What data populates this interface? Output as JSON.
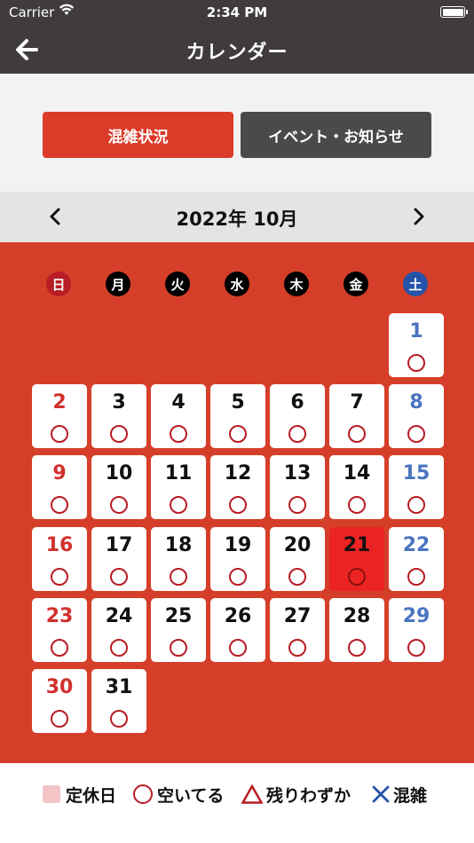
{
  "status_bar": {
    "carrier": "Carrier",
    "time": "2:34 PM"
  },
  "nav": {
    "title": "カレンダー"
  },
  "segments": [
    {
      "label": "混雑状況",
      "active": true
    },
    {
      "label": "イベント・お知らせ",
      "active": false
    }
  ],
  "month": {
    "label": "2022年 10月"
  },
  "weekdays": [
    "日",
    "月",
    "火",
    "水",
    "木",
    "金",
    "土"
  ],
  "days": [
    {
      "day": "1",
      "col": 6,
      "row": 0
    },
    {
      "day": "2",
      "col": 0,
      "row": 1
    },
    {
      "day": "3",
      "col": 1,
      "row": 1
    },
    {
      "day": "4",
      "col": 2,
      "row": 1
    },
    {
      "day": "5",
      "col": 3,
      "row": 1
    },
    {
      "day": "6",
      "col": 4,
      "row": 1
    },
    {
      "day": "7",
      "col": 5,
      "row": 1
    },
    {
      "day": "8",
      "col": 6,
      "row": 1
    },
    {
      "day": "9",
      "col": 0,
      "row": 2
    },
    {
      "day": "10",
      "col": 1,
      "row": 2
    },
    {
      "day": "11",
      "col": 2,
      "row": 2
    },
    {
      "day": "12",
      "col": 3,
      "row": 2
    },
    {
      "day": "13",
      "col": 4,
      "row": 2
    },
    {
      "day": "14",
      "col": 5,
      "row": 2
    },
    {
      "day": "15",
      "col": 6,
      "row": 2
    },
    {
      "day": "16",
      "col": 0,
      "row": 3
    },
    {
      "day": "17",
      "col": 1,
      "row": 3
    },
    {
      "day": "18",
      "col": 2,
      "row": 3
    },
    {
      "day": "19",
      "col": 3,
      "row": 3
    },
    {
      "day": "20",
      "col": 4,
      "row": 3
    },
    {
      "day": "21",
      "col": 5,
      "row": 3,
      "today": true
    },
    {
      "day": "22",
      "col": 6,
      "row": 3
    },
    {
      "day": "23",
      "col": 0,
      "row": 4
    },
    {
      "day": "24",
      "col": 1,
      "row": 4
    },
    {
      "day": "25",
      "col": 2,
      "row": 4
    },
    {
      "day": "26",
      "col": 3,
      "row": 4
    },
    {
      "day": "27",
      "col": 4,
      "row": 4
    },
    {
      "day": "28",
      "col": 5,
      "row": 4
    },
    {
      "day": "29",
      "col": 6,
      "row": 4
    },
    {
      "day": "30",
      "col": 0,
      "row": 5
    },
    {
      "day": "31",
      "col": 1,
      "row": 5
    }
  ],
  "legend": {
    "closed": "定休日",
    "open": "空いてる",
    "few": "残りわずか",
    "busy": "混雑"
  },
  "colors": {
    "header": "#3f3c3b",
    "accent": "#db3b28",
    "calendar_bg": "#d53f2a",
    "today": "#ec2323",
    "sunday": "#d0312d",
    "saturday": "#4a74c0",
    "available_mark": "#b81c24",
    "busy_mark": "#2553a8"
  },
  "icons": {
    "back": "back-arrow-icon",
    "prev": "chevron-left-icon",
    "next": "chevron-right-icon"
  }
}
